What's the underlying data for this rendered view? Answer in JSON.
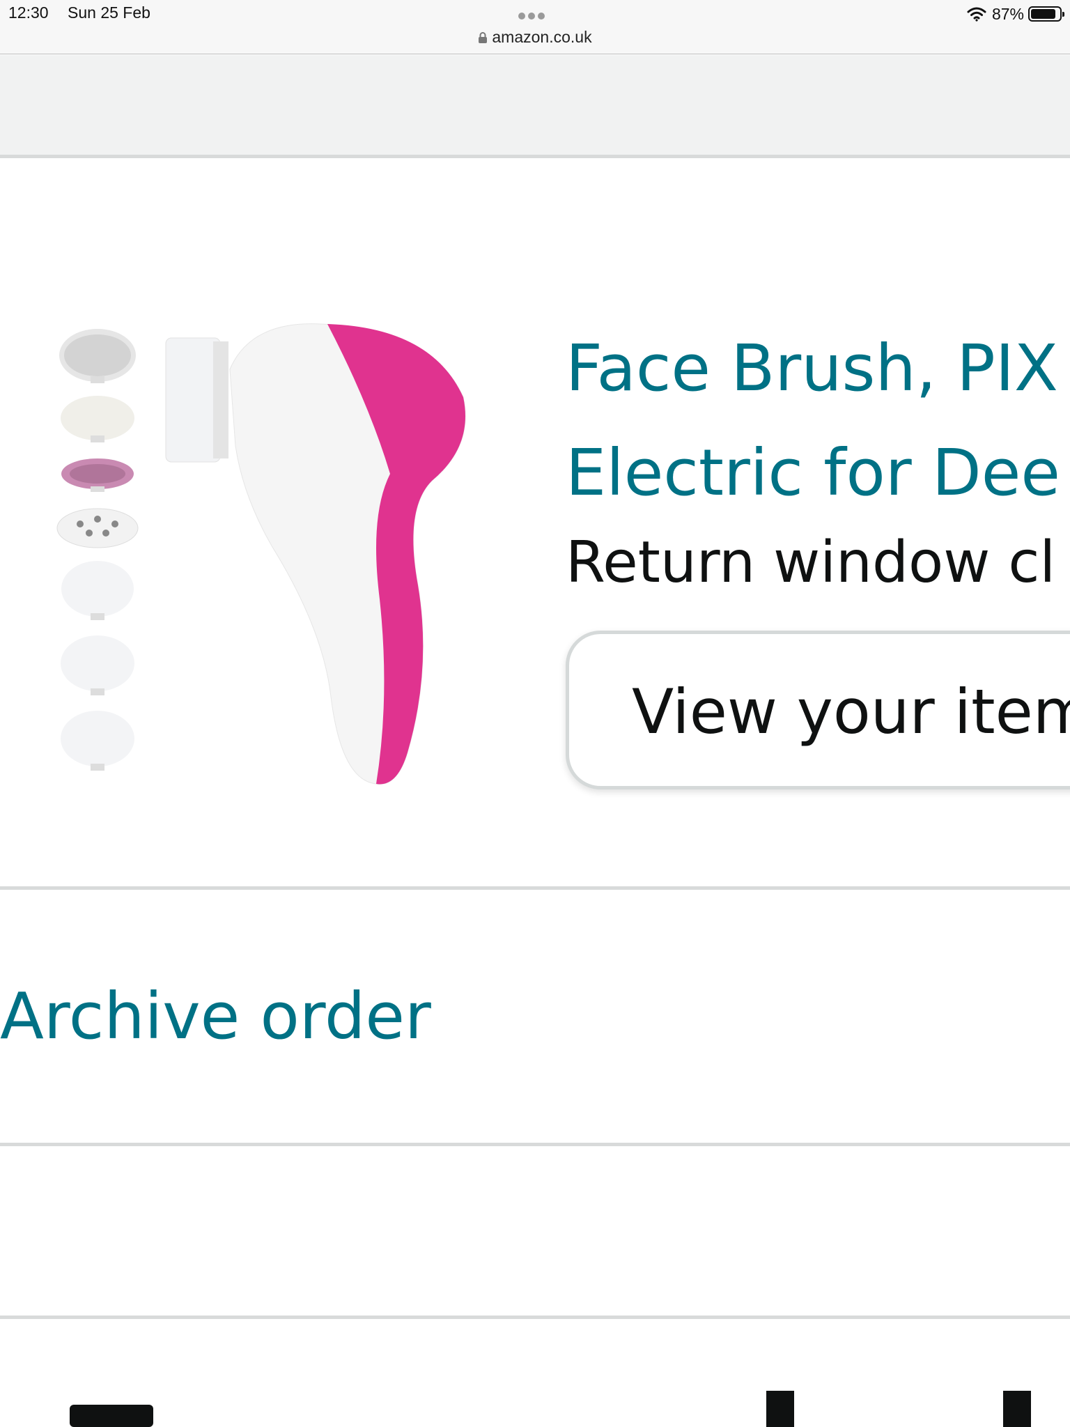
{
  "status_bar": {
    "time": "12:30",
    "date": "Sun 25 Feb",
    "url": "amazon.co.uk",
    "battery_percent": "87%",
    "battery_level": 0.87
  },
  "order_item": {
    "title_line1": "Face Brush, PIX",
    "title_line2": "Electric for Dee",
    "return_window": "Return window cl",
    "view_button_label": "View your item",
    "image_icon": "face-brush-product-image",
    "accent_color": "#e0338f"
  },
  "actions": {
    "archive_label": "Archive order"
  },
  "colors": {
    "link": "#007185",
    "text": "#0f1111",
    "divider": "#d8dada",
    "header_band": "#f1f2f2"
  }
}
